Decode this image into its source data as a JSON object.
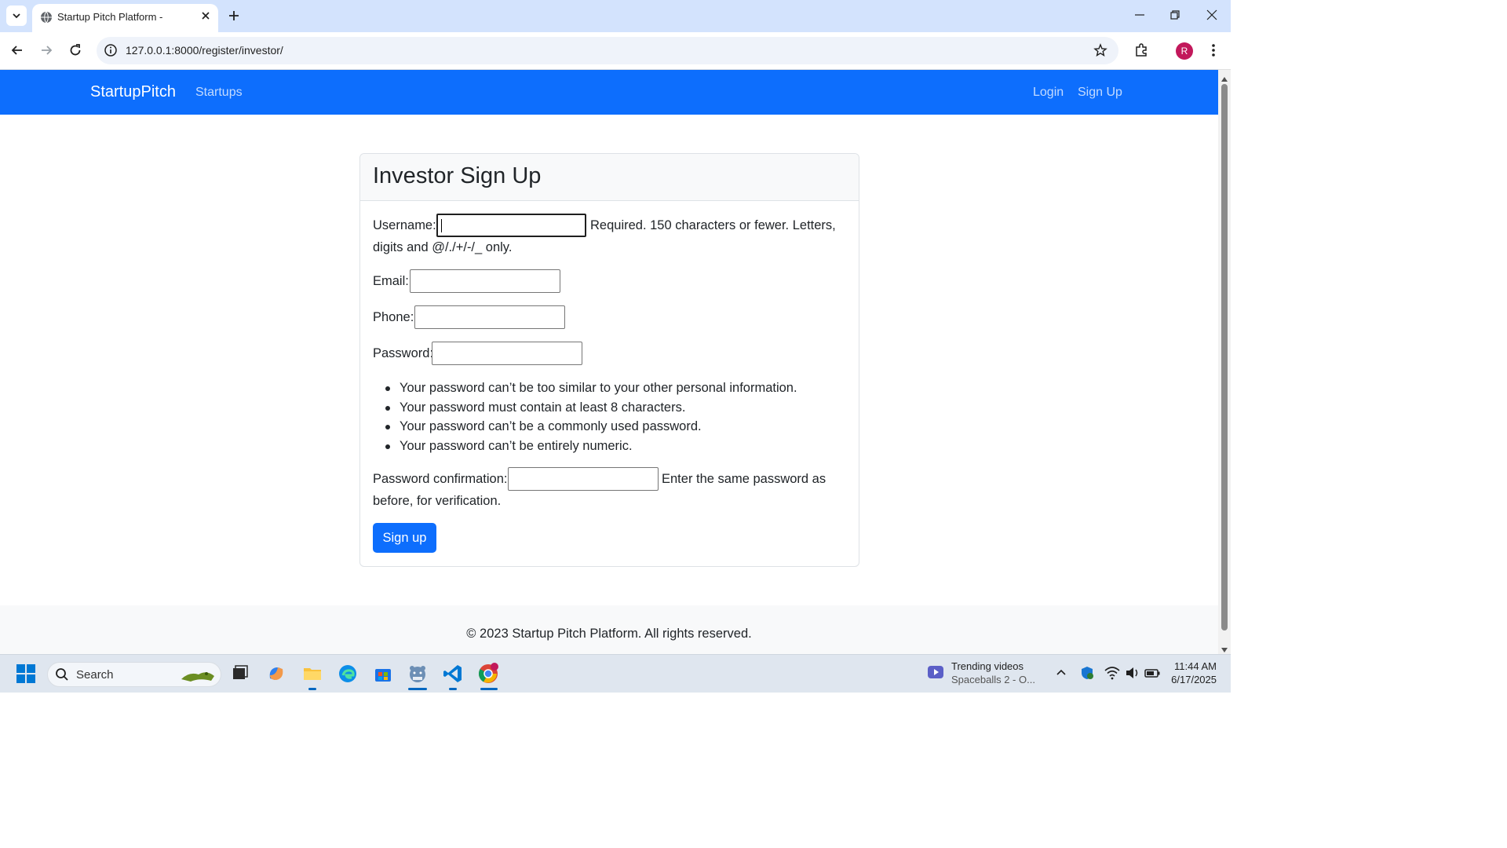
{
  "browser": {
    "tab_title": "Startup Pitch Platform -",
    "url": "127.0.0.1:8000/register/investor/",
    "profile_initial": "R"
  },
  "navbar": {
    "brand": "StartupPitch",
    "links": [
      "Startups"
    ],
    "right_links": [
      "Login",
      "Sign Up"
    ]
  },
  "form": {
    "title": "Investor Sign Up",
    "username_label": "Username:",
    "username_help_1": "Required. 150 characters or fewer. Letters,",
    "username_help_2": "digits and @/./+/-/_ only.",
    "email_label": "Email:",
    "phone_label": "Phone:",
    "password_label": "Password:",
    "password_rules": [
      "Your password can’t be too similar to your other personal information.",
      "Your password must contain at least 8 characters.",
      "Your password can’t be a commonly used password.",
      "Your password can’t be entirely numeric."
    ],
    "confirm_label": "Password confirmation:",
    "confirm_help_1": "Enter the same password as",
    "confirm_help_2": "before, for verification.",
    "submit_label": "Sign up"
  },
  "footer": {
    "text": "© 2023 Startup Pitch Platform. All rights reserved."
  },
  "taskbar": {
    "search_label": "Search",
    "widget_title": "Trending videos",
    "widget_subtitle": "Spaceballs 2 - O...",
    "time": "11:44 AM",
    "date": "6/17/2025"
  },
  "colors": {
    "primary": "#0d6efd",
    "tabbar": "#d3e3fd",
    "footer_bg": "#f8f9fa"
  }
}
